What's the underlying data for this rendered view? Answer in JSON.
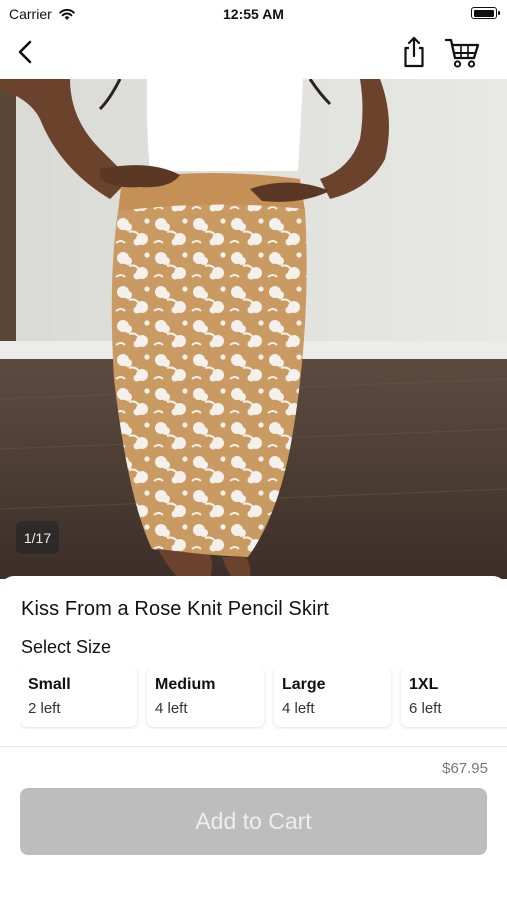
{
  "status_bar": {
    "carrier": "Carrier",
    "time": "12:55 AM"
  },
  "nav": {
    "icons": [
      "back-icon",
      "share-icon",
      "cart-icon"
    ]
  },
  "gallery": {
    "counter": "1/17"
  },
  "product": {
    "title": "Kiss From a Rose Knit Pencil Skirt",
    "size_heading": "Select Size",
    "sizes": [
      {
        "name": "Small",
        "stock": "2 left"
      },
      {
        "name": "Medium",
        "stock": "4 left"
      },
      {
        "name": "Large",
        "stock": "4 left"
      },
      {
        "name": "1XL",
        "stock": "6 left"
      }
    ],
    "price": "$67.95",
    "add_to_cart_label": "Add to Cart"
  },
  "colors": {
    "skirt_base": "#c99a62",
    "button_disabled": "#bdbdbd"
  }
}
